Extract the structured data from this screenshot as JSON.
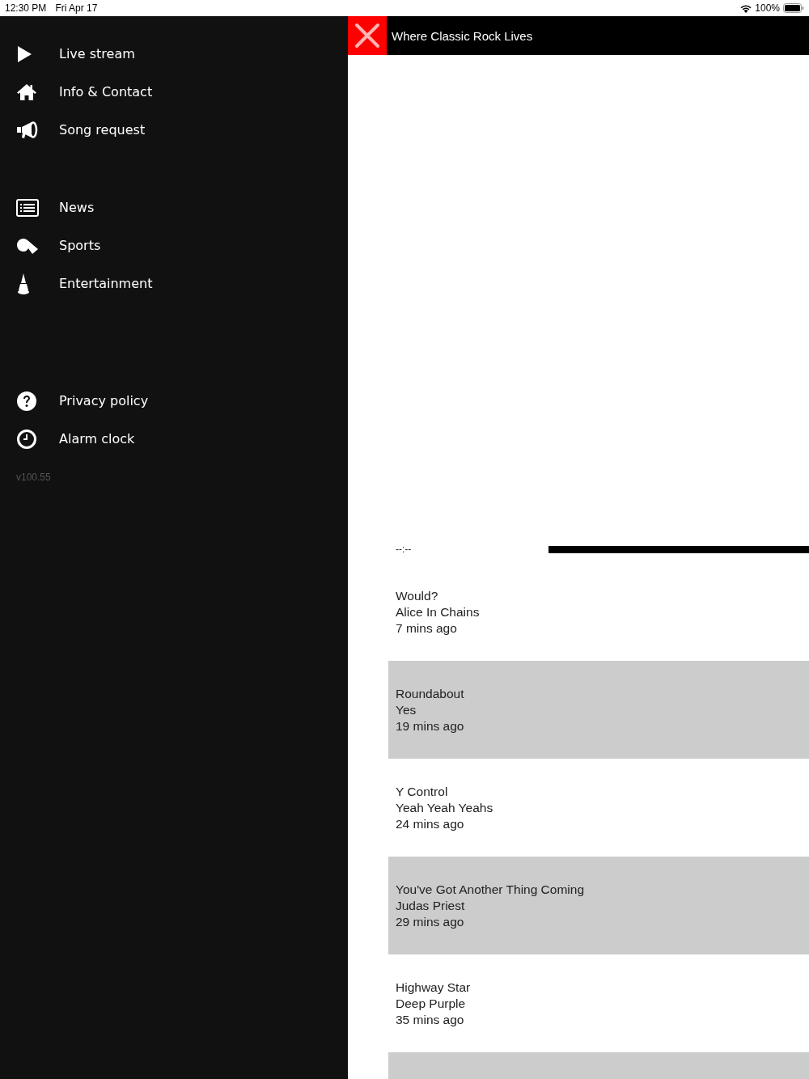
{
  "status_bar": {
    "time": "12:30 PM",
    "date": "Fri Apr 17",
    "battery": "100%"
  },
  "sidebar": {
    "groups": [
      {
        "items": [
          {
            "label": "Live stream"
          },
          {
            "label": "Info & Contact"
          },
          {
            "label": "Song request"
          }
        ]
      },
      {
        "items": [
          {
            "label": "News"
          },
          {
            "label": "Sports"
          },
          {
            "label": "Entertainment"
          }
        ]
      },
      {
        "items": [
          {
            "label": "Privacy policy"
          },
          {
            "label": "Alarm clock"
          }
        ]
      }
    ],
    "version": "v100.55"
  },
  "header": {
    "title": "Where Classic Rock Lives"
  },
  "player": {
    "time": "--:--",
    "level": 1
  },
  "history": [
    {
      "title": "Would?",
      "artist": "Alice In Chains",
      "ago": "7 mins ago",
      "shaded": false
    },
    {
      "title": "Roundabout",
      "artist": "Yes",
      "ago": "19 mins ago",
      "shaded": true
    },
    {
      "title": "Y Control",
      "artist": "Yeah Yeah Yeahs",
      "ago": "24 mins ago",
      "shaded": false
    },
    {
      "title": "You've Got Another Thing Coming",
      "artist": "Judas Priest",
      "ago": "29 mins ago",
      "shaded": true
    },
    {
      "title": "Highway Star",
      "artist": "Deep Purple",
      "ago": "35 mins ago",
      "shaded": false
    }
  ]
}
